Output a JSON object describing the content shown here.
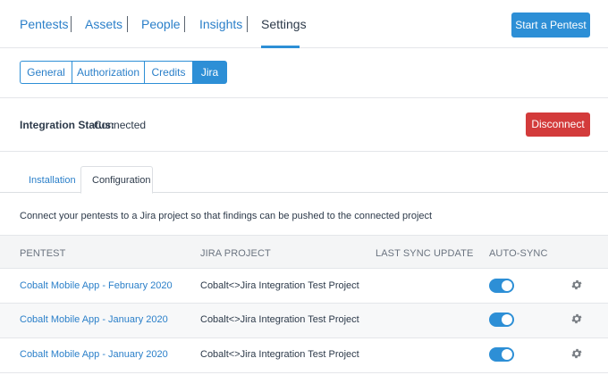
{
  "topnav": {
    "items": [
      {
        "label": "Pentests",
        "active": false
      },
      {
        "label": "Assets",
        "active": false
      },
      {
        "label": "People",
        "active": false
      },
      {
        "label": "Insights",
        "active": false
      },
      {
        "label": "Settings",
        "active": true
      }
    ],
    "cta_label": "Start a Pentest"
  },
  "settings_tabs": [
    {
      "label": "General"
    },
    {
      "label": "Authorization"
    },
    {
      "label": "Credits"
    },
    {
      "label": "Jira",
      "selected": true
    }
  ],
  "integration": {
    "label": "Integration Status:",
    "value": "Connected",
    "disconnect_label": "Disconnect"
  },
  "jira_tabs": [
    {
      "label": "Installation",
      "active": false
    },
    {
      "label": "Configuration",
      "active": true
    }
  ],
  "description": "Connect your pentests to a Jira project so that findings can be pushed to the connected project",
  "table": {
    "columns": [
      "PENTEST",
      "JIRA PROJECT",
      "LAST SYNC UPDATE",
      "AUTO-SYNC"
    ],
    "rows": [
      {
        "pentest": "Cobalt Mobile App - February 2020",
        "project": "Cobalt<>Jira Integration Test Project",
        "last_sync": "",
        "auto_sync": true
      },
      {
        "pentest": "Cobalt Mobile App - January 2020",
        "project": "Cobalt<>Jira Integration Test Project",
        "last_sync": "",
        "auto_sync": true
      },
      {
        "pentest": "Cobalt Mobile App - January 2020",
        "project": "Cobalt<>Jira Integration Test Project",
        "last_sync": "",
        "auto_sync": true
      }
    ]
  },
  "colors": {
    "accent": "#2d8fd6",
    "link": "#2a7fc9",
    "danger": "#d33b3b",
    "text": "#2d3a4a",
    "icon": "#7a7f85"
  },
  "icons": {
    "settings": "gear-icon"
  }
}
